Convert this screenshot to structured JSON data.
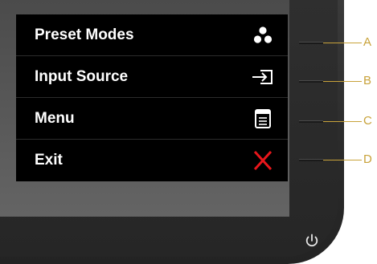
{
  "osd": {
    "items": [
      {
        "label": "Preset Modes",
        "icon": "preset-modes-icon",
        "callout": "A"
      },
      {
        "label": "Input Source",
        "icon": "input-source-icon",
        "callout": "B"
      },
      {
        "label": "Menu",
        "icon": "menu-icon",
        "callout": "C"
      },
      {
        "label": "Exit",
        "icon": "close-icon",
        "callout": "D"
      }
    ]
  },
  "power": {
    "icon": "power-icon"
  },
  "colors": {
    "osd_background": "#000000",
    "osd_text": "#ffffff",
    "exit_icon": "#e8161b",
    "callout": "#c8a23a"
  }
}
